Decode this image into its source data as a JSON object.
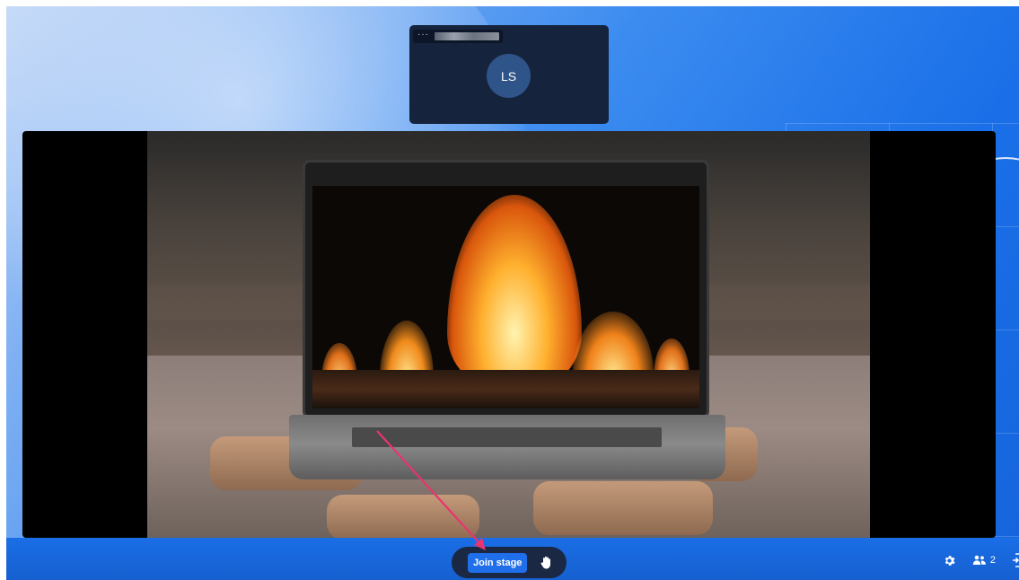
{
  "participant": {
    "options_glyph": "···",
    "initials": "LS"
  },
  "stage": {
    "content": "screen-share-video"
  },
  "controls": {
    "join_stage_label": "Join stage",
    "raise_hand_icon": "hand-icon",
    "settings_icon": "gear-icon",
    "participants_icon": "people-icon",
    "participants_count": "2",
    "leave_icon": "exit-icon"
  },
  "colors": {
    "accent": "#1f6feb",
    "bar": "#1660d0",
    "tile": "#15233d",
    "annotation": "#e8346f"
  }
}
